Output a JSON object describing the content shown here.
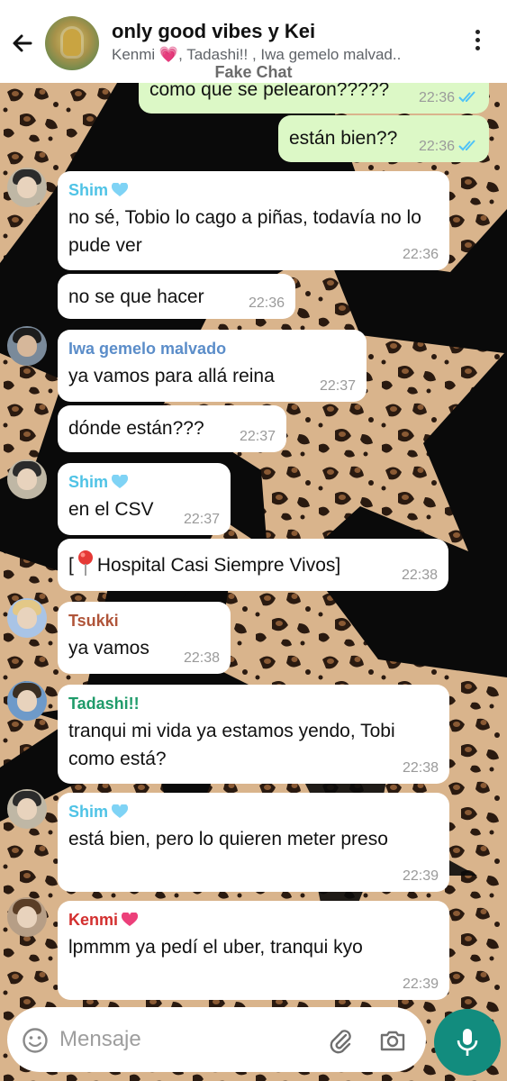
{
  "header": {
    "title": "only good vibes y Kei",
    "members": "Kenmi 💗, Tadashi!! , Iwa gemelo malvad..",
    "watermark": "Fake Chat"
  },
  "colors": {
    "outgoing_bubble": "#dcf8c6",
    "incoming_bubble": "#ffffff",
    "accent": "#128c7e",
    "read_ticks": "#4fc3f7",
    "sender_shim": "#4fc3e6",
    "sender_iwa": "#5b8dc9",
    "sender_tsukki": "#b0553a",
    "sender_tadashi": "#1f9b6a",
    "sender_kenmi": "#d32f2f"
  },
  "icons": {
    "back": "arrow-left-icon",
    "more": "more-vert-icon",
    "emoji": "smiley-icon",
    "attach": "paperclip-icon",
    "camera": "camera-icon",
    "mic": "microphone-icon",
    "heart_blue": "blue-heart-emoji",
    "heart_pink": "pink-heart-emoji",
    "pin": "round-pushpin-emoji"
  },
  "messages": [
    {
      "type": "out",
      "text": "como que se pelearon?????",
      "time": "22:36"
    },
    {
      "type": "out",
      "text": "están bien??",
      "time": "22:36"
    },
    {
      "type": "in",
      "sender": "Shim",
      "text": "no sé, Tobio lo cago a piñas, todavía no lo pude ver",
      "time": "22:36"
    },
    {
      "type": "in",
      "text": "no se que hacer",
      "time": "22:36"
    },
    {
      "type": "in",
      "sender": "Iwa gemelo malvado",
      "text": "ya vamos para allá reina",
      "time": "22:37"
    },
    {
      "type": "in",
      "text": "dónde están???",
      "time": "22:37"
    },
    {
      "type": "in",
      "sender": "Shim",
      "text": "en el CSV",
      "time": "22:37"
    },
    {
      "type": "in",
      "text_pre": "[",
      "text_post": "Hospital Casi Siempre Vivos]",
      "time": "22:38"
    },
    {
      "type": "in",
      "sender": "Tsukki",
      "text": "ya vamos",
      "time": "22:38"
    },
    {
      "type": "in",
      "sender": "Tadashi!!",
      "text": "tranqui mi vida ya estamos yendo, Tobi como está?",
      "time": "22:38"
    },
    {
      "type": "in",
      "sender": "Shim",
      "text": "está bien, pero lo quieren meter preso",
      "time": "22:39"
    },
    {
      "type": "in",
      "sender": "Kenmi",
      "text": "lpmmm ya pedí el uber, tranqui kyo",
      "time": "22:39"
    }
  ],
  "composer": {
    "placeholder": "Mensaje"
  }
}
